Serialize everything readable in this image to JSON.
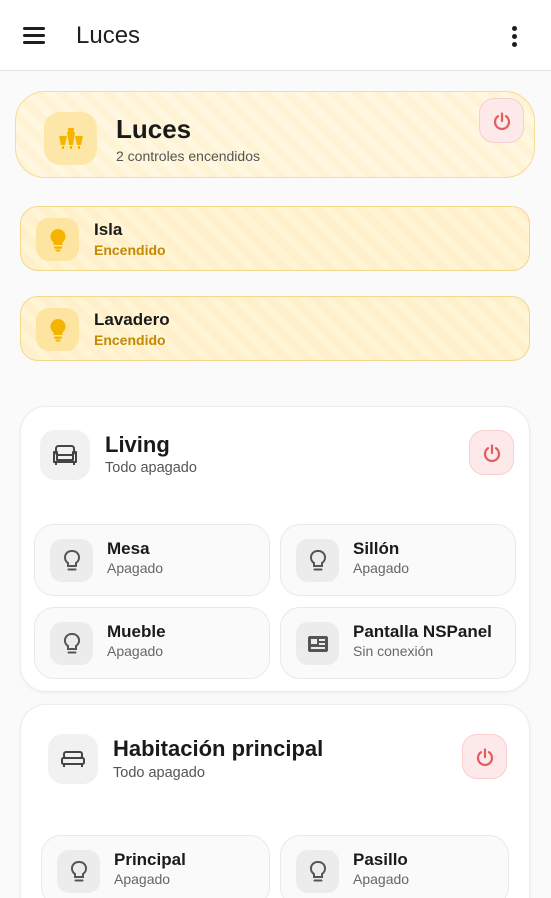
{
  "appbar": {
    "title": "Luces",
    "menu_icon": "menu-icon",
    "more_icon": "more-vert-icon"
  },
  "hero": {
    "title": "Luces",
    "subtitle": "2 controles encendidos",
    "icon": "chandelier-icon",
    "power_icon": "power-icon"
  },
  "lights_on": [
    {
      "name": "Isla",
      "state": "Encendido",
      "icon": "bulb-icon"
    },
    {
      "name": "Lavadero",
      "state": "Encendido",
      "icon": "bulb-icon"
    }
  ],
  "rooms": [
    {
      "title": "Living",
      "subtitle": "Todo apagado",
      "icon": "sofa-icon",
      "tiles": [
        {
          "name": "Mesa",
          "state": "Apagado",
          "icon": "bulb-outline-icon"
        },
        {
          "name": "Sillón",
          "state": "Apagado",
          "icon": "bulb-outline-icon"
        },
        {
          "name": "Mueble",
          "state": "Apagado",
          "icon": "bulb-outline-icon"
        },
        {
          "name": "Pantalla NSPanel",
          "state": "Sin conexión",
          "icon": "panel-screen-icon"
        }
      ]
    },
    {
      "title": "Habitación principal",
      "subtitle": "Todo apagado",
      "icon": "bed-icon",
      "tiles": [
        {
          "name": "Principal",
          "state": "Apagado",
          "icon": "bulb-outline-icon"
        },
        {
          "name": "Pasillo",
          "state": "Apagado",
          "icon": "bulb-outline-icon"
        }
      ]
    }
  ],
  "colors": {
    "accent_on": "#f5b400",
    "on_text": "#c38a00",
    "power": "#e35d5d",
    "icon_off": "#555555"
  }
}
